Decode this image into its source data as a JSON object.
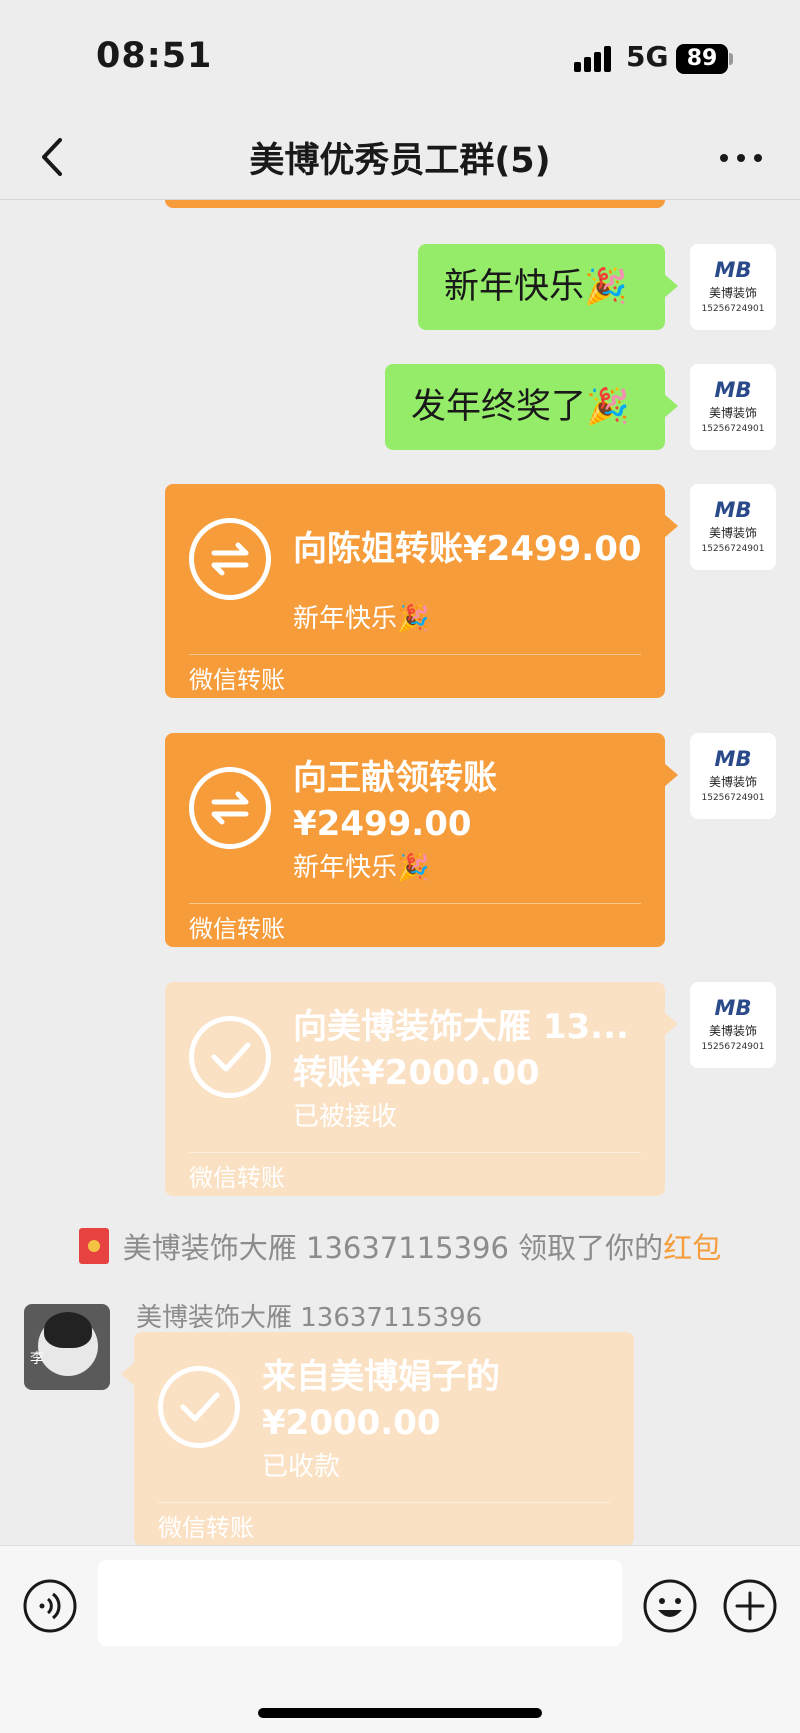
{
  "status_bar": {
    "time": "08:51",
    "network": "5G",
    "battery": "89"
  },
  "nav": {
    "title": "美博优秀员工群(5)"
  },
  "messages": [
    {
      "type": "text",
      "text": "新年快乐🎉"
    },
    {
      "type": "text",
      "text": "发年终奖了🎉"
    },
    {
      "type": "transfer",
      "title": "向陈姐转账¥2499.00",
      "note": "新年快乐🎉",
      "footer": "微信转账"
    },
    {
      "type": "transfer",
      "title_line1": "向王献领转账",
      "title_line2": "¥2499.00",
      "note": "新年快乐🎉",
      "footer": "微信转账"
    },
    {
      "type": "transfer",
      "title_line1": "向美博装饰大雁 13...",
      "title_line2": "转账¥2000.00",
      "note": "已被接收",
      "footer": "微信转账"
    }
  ],
  "avatar": {
    "logo": "MB",
    "brand": "美博装饰",
    "phone": "15256724901"
  },
  "system": {
    "prefix": "美博装饰大雁 13637115396 领取了你的",
    "highlight": "红包"
  },
  "incoming": {
    "sender": "美博装饰大雁 13637115396",
    "avatar_char": "李",
    "title_line1": "来自美博娟子的",
    "title_line2": "¥2000.00",
    "note": "已收款",
    "footer": "微信转账"
  },
  "colors": {
    "green_bubble": "#95ec69",
    "transfer_orange": "#f79c3a",
    "transfer_faded": "#fbe1c4"
  },
  "input": {
    "value": ""
  }
}
